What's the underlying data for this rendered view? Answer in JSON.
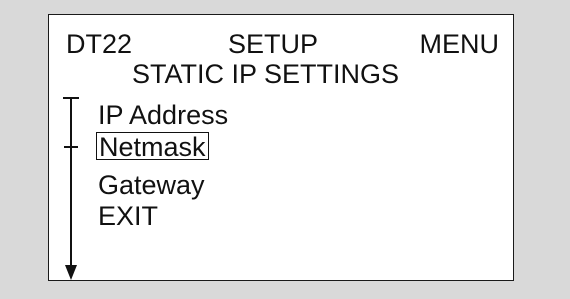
{
  "header": {
    "device": "DT22",
    "mode": "SETUP",
    "menu_label": "MENU"
  },
  "subtitle": "STATIC IP SETTINGS",
  "menu": {
    "items": [
      {
        "label": "IP Address",
        "selected": false
      },
      {
        "label": "Netmask",
        "selected": true
      },
      {
        "label": "Gateway",
        "selected": false
      },
      {
        "label": "EXIT",
        "selected": false
      }
    ]
  },
  "scrollbar": {
    "icons": [
      "scroll-track-icon",
      "scroll-position-icon",
      "scroll-down-arrow-icon"
    ]
  },
  "colors": {
    "background": "#d9d9d9",
    "screen": "#ffffff",
    "text": "#111111"
  }
}
